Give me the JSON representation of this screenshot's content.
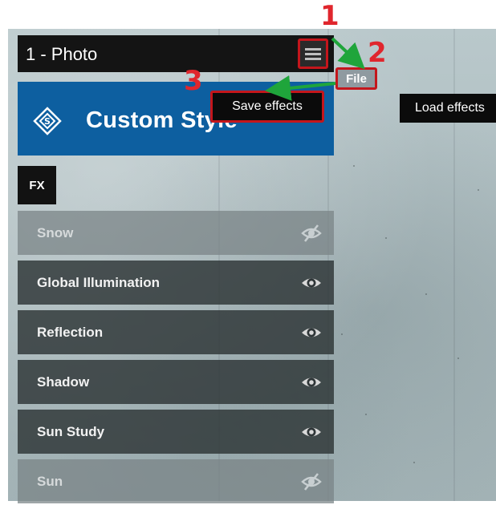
{
  "panel": {
    "title": "1 - Photo"
  },
  "style": {
    "label": "Custom Style"
  },
  "fx": {
    "label": "FX"
  },
  "effects": [
    {
      "name": "Snow",
      "visible": false
    },
    {
      "name": "Global Illumination",
      "visible": true
    },
    {
      "name": "Reflection",
      "visible": true
    },
    {
      "name": "Shadow",
      "visible": true
    },
    {
      "name": "Sun Study",
      "visible": true
    },
    {
      "name": "Sun",
      "visible": false
    }
  ],
  "menu": {
    "file_label": "File",
    "save_effects_label": "Save effects",
    "load_effects_label": "Load effects"
  },
  "steps": {
    "one": "1",
    "two": "2",
    "three": "3"
  },
  "colors": {
    "accent": "#0d5fa0",
    "annotation": "#e0262d",
    "arrow": "#1fa53b"
  },
  "icons": {
    "menu": "hamburger-icon",
    "style": "layers-icon",
    "visible": "eye-icon",
    "hidden": "eye-slash-icon"
  }
}
